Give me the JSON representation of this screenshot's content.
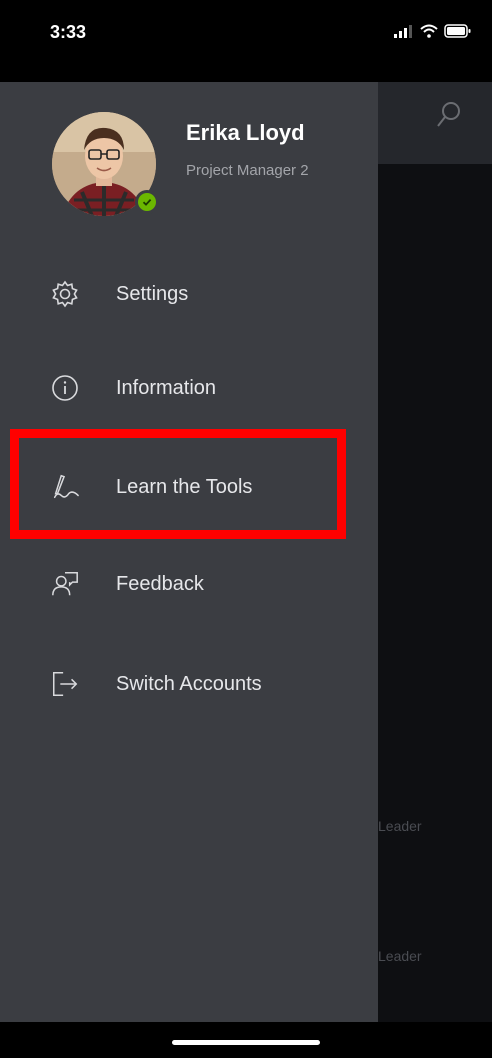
{
  "status_bar": {
    "time": "3:33"
  },
  "profile": {
    "name": "Erika Lloyd",
    "role": "Project Manager 2",
    "presence": "available"
  },
  "menu": {
    "items": [
      {
        "label": "Settings",
        "icon": "gear-icon"
      },
      {
        "label": "Information",
        "icon": "info-icon"
      },
      {
        "label": "Learn the Tools",
        "icon": "signature-icon"
      },
      {
        "label": "Feedback",
        "icon": "feedback-icon"
      },
      {
        "label": "Switch Accounts",
        "icon": "sign-out-icon"
      }
    ]
  },
  "background_list": {
    "rows": [
      {
        "text": "Leader"
      },
      {
        "text": "Leader"
      }
    ]
  },
  "colors": {
    "drawer": "#3b3d42",
    "highlight": "#ff0000",
    "presence": "#6bb700"
  }
}
